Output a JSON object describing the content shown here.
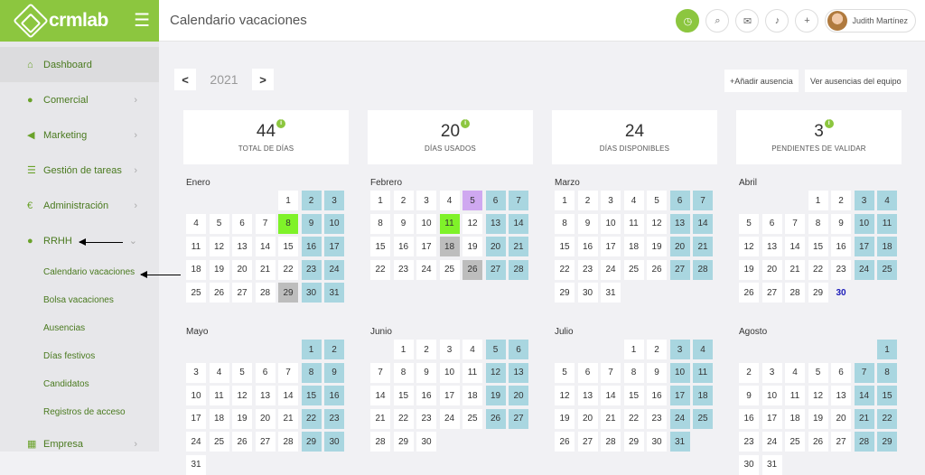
{
  "app": {
    "logo_text": "crmlab",
    "page_title": "Calendario vacaciones"
  },
  "topbar": {
    "user_name": "Judith Martínez"
  },
  "sidebar": {
    "items": [
      {
        "label": "Dashboard",
        "icon": "home-icon",
        "glyph": "⌂",
        "chev": false
      },
      {
        "label": "Comercial",
        "icon": "user-icon",
        "glyph": "●",
        "chev": true
      },
      {
        "label": "Marketing",
        "icon": "megaphone-icon",
        "glyph": "◀",
        "chev": true
      },
      {
        "label": "Gestión de tareas",
        "icon": "tasks-icon",
        "glyph": "☰",
        "chev": true
      },
      {
        "label": "Administración",
        "icon": "euro-icon",
        "glyph": "€",
        "chev": true
      },
      {
        "label": "RRHH",
        "icon": "users-icon",
        "glyph": "●",
        "chev": true
      }
    ],
    "sub_items": [
      "Calendario vacaciones",
      "Bolsa vacaciones",
      "Ausencias",
      "Días festivos",
      "Candidatos",
      "Registros de acceso"
    ],
    "last_item": {
      "label": "Empresa",
      "icon": "building-icon"
    }
  },
  "controls": {
    "year": "2021",
    "prev": "<",
    "next": ">",
    "add_absence": "+Añadir ausencia",
    "team_absences": "Ver ausencias del equipo"
  },
  "stats": [
    {
      "value": "44",
      "label": "TOTAL DE DÍAS",
      "info": true
    },
    {
      "value": "20",
      "label": "DÍAS USADOS",
      "info": true
    },
    {
      "value": "24",
      "label": "DÍAS DISPONIBLES",
      "info": false
    },
    {
      "value": "3",
      "label": "PENDIENTES DE VALIDAR",
      "info": true
    }
  ],
  "info_glyph": "i",
  "colors": {
    "accent": "#8cc63f",
    "weekend": "#a9d6e0",
    "holiday": "#7ff229",
    "gray": "#bdbdbd",
    "pending": "#cfa8f0",
    "today": "#1a1ab8"
  },
  "months": [
    {
      "name": "Enero",
      "offset": 4,
      "days": 31,
      "hol": [
        8
      ],
      "gray": [
        29
      ],
      "purple": [],
      "today": null
    },
    {
      "name": "Febrero",
      "offset": 0,
      "days": 28,
      "hol": [
        11
      ],
      "gray": [
        18,
        26
      ],
      "purple": [
        5
      ],
      "today": null
    },
    {
      "name": "Marzo",
      "offset": 0,
      "days": 31,
      "hol": [],
      "gray": [],
      "purple": [],
      "today": null
    },
    {
      "name": "Abril",
      "offset": 3,
      "days": 30,
      "hol": [],
      "gray": [],
      "purple": [],
      "today": 30
    },
    {
      "name": "Mayo",
      "offset": 5,
      "days": 31,
      "hol": [],
      "gray": [],
      "purple": [],
      "today": null
    },
    {
      "name": "Junio",
      "offset": 1,
      "days": 30,
      "hol": [],
      "gray": [],
      "purple": [],
      "today": null
    },
    {
      "name": "Julio",
      "offset": 3,
      "days": 31,
      "hol": [],
      "gray": [],
      "purple": [],
      "today": null
    },
    {
      "name": "Agosto",
      "offset": 6,
      "days": 31,
      "hol": [],
      "gray": [],
      "purple": [],
      "today": null
    }
  ]
}
